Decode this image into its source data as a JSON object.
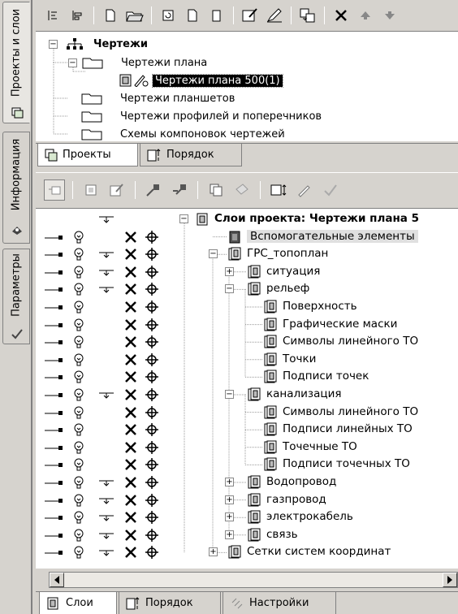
{
  "side_tabs": [
    {
      "label": "Проекты и слои",
      "icon": "layers-icon",
      "active": true
    },
    {
      "label": "Информация",
      "icon": "info-icon",
      "active": false
    },
    {
      "label": "Параметры",
      "icon": "checkmark-icon",
      "active": false
    }
  ],
  "toolbar_top": {
    "buttons": [
      "align-left-icon",
      "align-center-icon",
      "new-document-icon",
      "open-folder-icon",
      "refresh-icon",
      "document-icon",
      "copy-document-icon",
      "properties-icon",
      "edit-pencil-icon",
      "import-icon",
      "delete-icon",
      "move-up-icon",
      "move-down-icon"
    ]
  },
  "project_tree": {
    "root": "Чертежи",
    "items": [
      {
        "label": "Чертежи плана",
        "level": 1,
        "expanded": true
      },
      {
        "label": "Чертежи плана 500(1)",
        "level": 2,
        "selected": true
      },
      {
        "label": "Чертежи планшетов",
        "level": 1
      },
      {
        "label": "Чертежи профилей и поперечников",
        "level": 1
      },
      {
        "label": "Схемы компоновок чертежей",
        "level": 1
      }
    ]
  },
  "project_tabs": [
    {
      "label": "Проекты",
      "active": true
    },
    {
      "label": "Порядок",
      "active": false
    }
  ],
  "toolbar_layers": {
    "buttons": [
      "layer-add-icon",
      "layer-icon",
      "layer-properties-icon",
      "link-icon",
      "unlink-icon",
      "copy-icon",
      "paint-icon",
      "frame-icon",
      "edit-icon",
      "apply-check-icon"
    ]
  },
  "layers": {
    "root": "Слои проекта: Чертежи плана 5",
    "rows": [
      {
        "label": "Вспомогательные элементы",
        "level": 1,
        "highlight": true,
        "sub": false,
        "toggle": "",
        "icon": "aux"
      },
      {
        "label": "ГРС_топоплан",
        "level": 1,
        "sub": true,
        "toggle": "−"
      },
      {
        "label": "ситуация",
        "level": 2,
        "sub": true,
        "toggle": "+"
      },
      {
        "label": "рельеф",
        "level": 2,
        "sub": true,
        "toggle": "−"
      },
      {
        "label": "Поверхность",
        "level": 3,
        "sub": false,
        "toggle": ""
      },
      {
        "label": "Графические маски",
        "level": 3,
        "sub": false,
        "toggle": ""
      },
      {
        "label": "Символы линейного ТО",
        "level": 3,
        "sub": false,
        "toggle": ""
      },
      {
        "label": "Точки",
        "level": 3,
        "sub": false,
        "toggle": ""
      },
      {
        "label": "Подписи точек",
        "level": 3,
        "sub": false,
        "toggle": ""
      },
      {
        "label": "канализация",
        "level": 2,
        "sub": true,
        "toggle": "−"
      },
      {
        "label": "Символы линейного ТО",
        "level": 3,
        "sub": false,
        "toggle": ""
      },
      {
        "label": "Подписи линейных ТО",
        "level": 3,
        "sub": false,
        "toggle": ""
      },
      {
        "label": "Точечные ТО",
        "level": 3,
        "sub": false,
        "toggle": ""
      },
      {
        "label": "Подписи точечных ТО",
        "level": 3,
        "sub": false,
        "toggle": ""
      },
      {
        "label": "Водопровод",
        "level": 2,
        "sub": true,
        "toggle": "+"
      },
      {
        "label": "газпровод",
        "level": 2,
        "sub": true,
        "toggle": "+"
      },
      {
        "label": "электрокабель",
        "level": 2,
        "sub": true,
        "toggle": "+"
      },
      {
        "label": "связь",
        "level": 2,
        "sub": true,
        "toggle": "+"
      },
      {
        "label": "Сетки систем координат",
        "level": 1,
        "sub": true,
        "toggle": "+"
      }
    ]
  },
  "bottom_tabs": [
    {
      "label": "Слои",
      "active": true
    },
    {
      "label": "Порядок",
      "active": false
    },
    {
      "label": "Настройки",
      "active": false
    }
  ]
}
